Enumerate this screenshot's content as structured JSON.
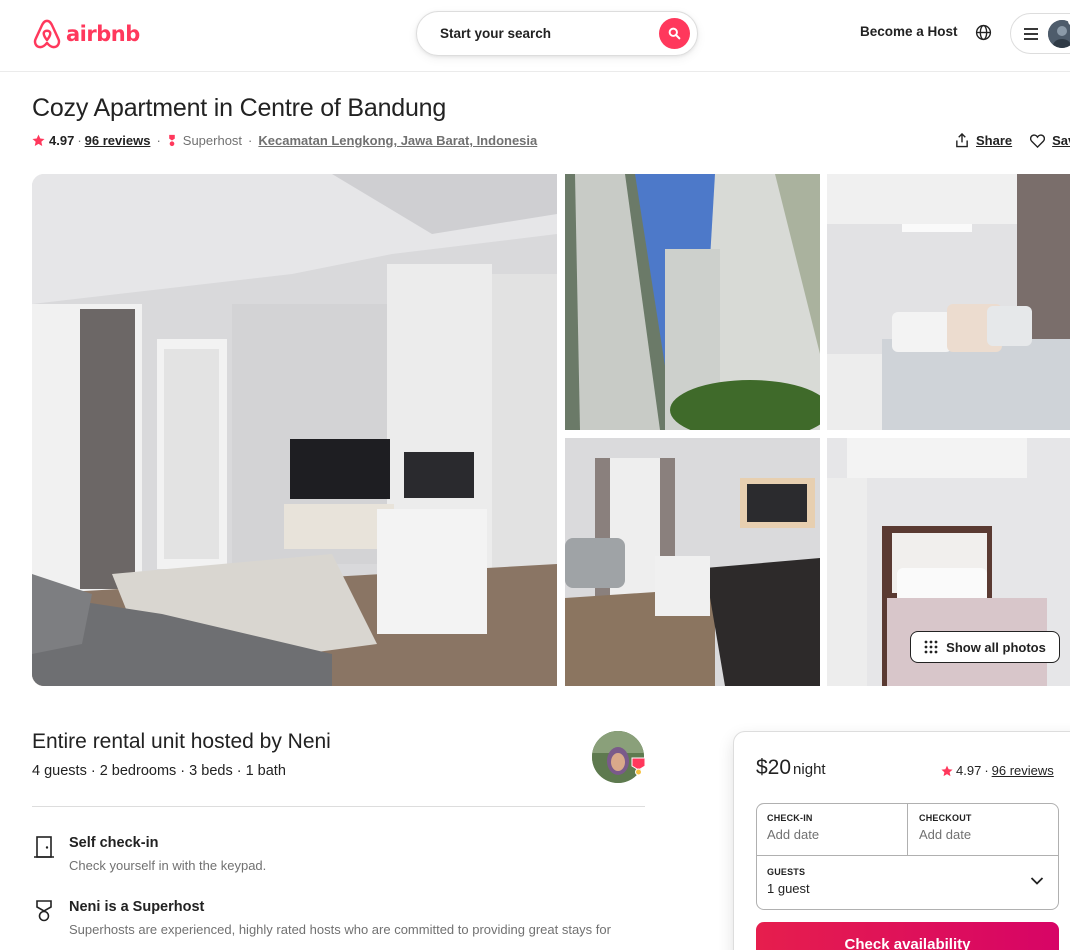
{
  "header": {
    "logo_text": "airbnb",
    "search_placeholder": "Start your search",
    "become_host": "Become a Host"
  },
  "listing": {
    "title": "Cozy Apartment in Centre of Bandung",
    "rating": "4.97",
    "reviews": "96 reviews",
    "superhost": "Superhost",
    "location": "Kecamatan Lengkong, Jawa Barat, Indonesia",
    "share": "Share",
    "save": "Save",
    "show_all_photos": "Show all photos"
  },
  "host": {
    "title": "Entire rental unit hosted by Neni",
    "summary": "4 guests · 2 bedrooms · 3 beds · 1 bath"
  },
  "features": [
    {
      "title": "Self check-in",
      "desc": "Check yourself in with the keypad."
    },
    {
      "title": "Neni is a Superhost",
      "desc": "Superhosts are experienced, highly rated hosts who are committed to providing great stays for"
    }
  ],
  "booking": {
    "price": "$20",
    "per": "night",
    "rating": "4.97",
    "reviews": "96 reviews",
    "checkin_label": "CHECK-IN",
    "checkin_value": "Add date",
    "checkout_label": "CHECKOUT",
    "checkout_value": "Add date",
    "guests_label": "GUESTS",
    "guests_value": "1 guest",
    "button": "Check availability"
  },
  "colors": {
    "brand": "#ff385c",
    "text": "#222222",
    "muted": "#717171"
  }
}
